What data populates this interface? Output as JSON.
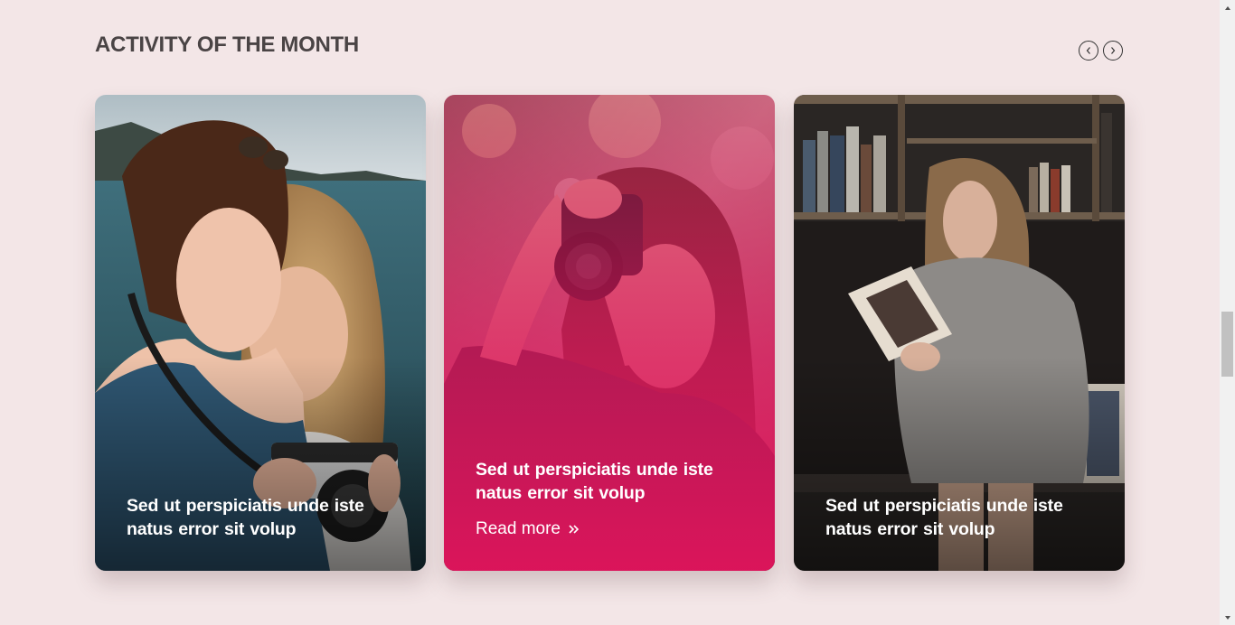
{
  "section": {
    "title": "ACTIVITY OF THE MONTH"
  },
  "carousel": {
    "prev_icon": "chevron-left-icon",
    "next_icon": "chevron-right-icon"
  },
  "cards": [
    {
      "text": "Sed ut perspiciatis unde   iste natus error sit volup",
      "image": "two-women-with-camera-by-sea-photo"
    },
    {
      "text": "Sed ut perspiciatis unde   iste natus error sit volup",
      "read_more": "Read more",
      "read_more_icon": "double-chevron-right-icon",
      "overlay_color": "#e0145c",
      "image": "woman-holding-camera-photo"
    },
    {
      "text": "Sed ut perspiciatis unde   iste natus error sit volup",
      "image": "woman-reading-book-by-bookshelf-photo"
    }
  ],
  "colors": {
    "background": "#f3e6e7",
    "title": "#4a4445",
    "accent": "#e0145c"
  }
}
